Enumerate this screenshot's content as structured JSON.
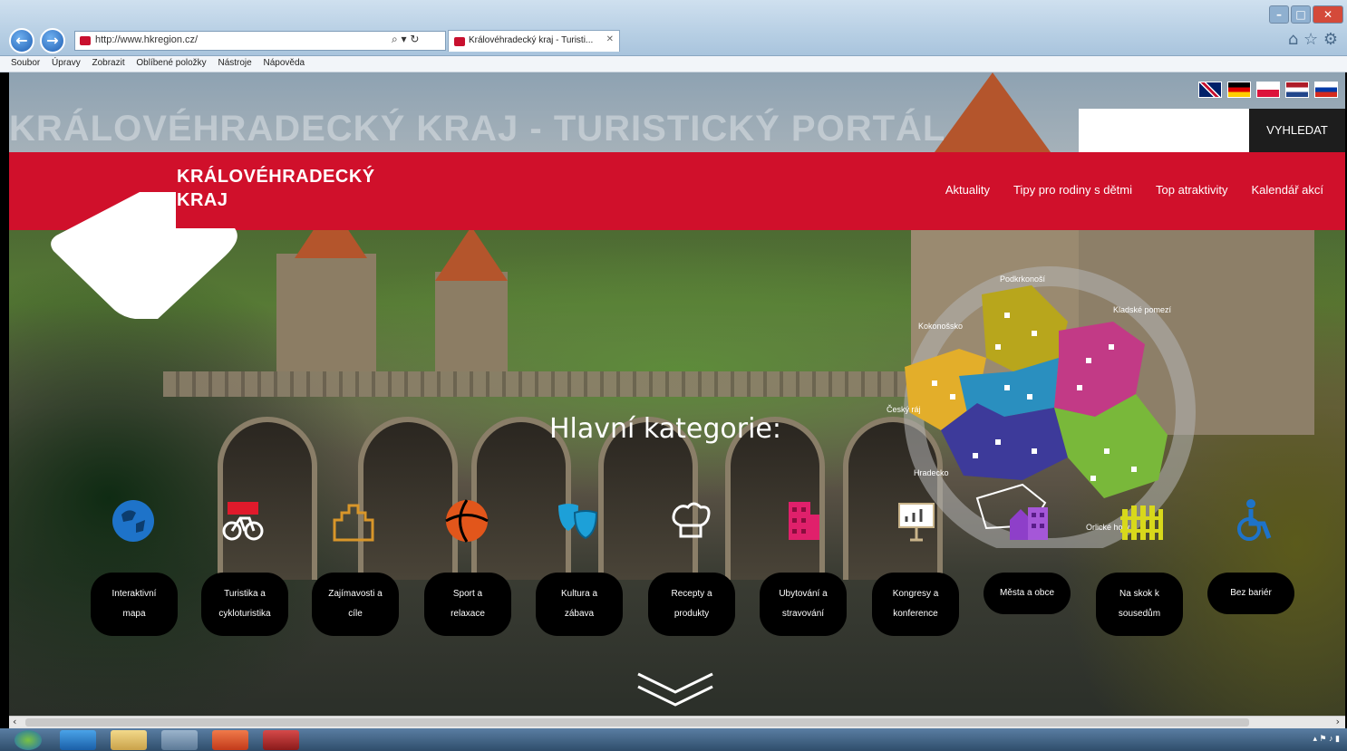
{
  "browser": {
    "address": "http://www.hkregion.cz/",
    "tab_title": "Královéhradecký kraj - Turisti...",
    "menu": [
      "Soubor",
      "Úpravy",
      "Zobrazit",
      "Oblíbené položky",
      "Nástroje",
      "Nápověda"
    ]
  },
  "site": {
    "headline": "KRÁLOVÉHRADECKÝ KRAJ - TURISTICKÝ PORTÁL",
    "logo_line1": "KRÁLOVÉHRADECKÝ",
    "logo_line2": "KRAJ",
    "search_button": "VYHLEDAT",
    "search_value": "",
    "nav": [
      "Aktuality",
      "Tipy pro rodiny s dětmi",
      "Top atraktivity",
      "Kalendář akcí"
    ],
    "categories_title": "Hlavní kategorie:",
    "languages": [
      "English",
      "Deutsch",
      "Polski",
      "Nederlands",
      "Русский"
    ]
  },
  "categories": [
    {
      "line1": "Interaktivní",
      "line2": "mapa",
      "icon": "globe-icon",
      "color": "#1e73c9"
    },
    {
      "line1": "Turistika a",
      "line2": "cykloturistika",
      "icon": "bicycle-icon",
      "color": "#e01a2b"
    },
    {
      "line1": "Zajímavosti a",
      "line2": "cíle",
      "icon": "castle-icon",
      "color": "#d8962a"
    },
    {
      "line1": "Sport a",
      "line2": "relaxace",
      "icon": "ball-icon",
      "color": "#e2561b"
    },
    {
      "line1": "Kultura a",
      "line2": "zábava",
      "icon": "theatre-masks-icon",
      "color": "#1da0d8"
    },
    {
      "line1": "Recepty a",
      "line2": "produkty",
      "icon": "chef-hat-icon",
      "color": "#ffffff"
    },
    {
      "line1": "Ubytování a",
      "line2": "stravování",
      "icon": "hotel-icon",
      "color": "#e0206b"
    },
    {
      "line1": "Kongresy a",
      "line2": "konference",
      "icon": "presentation-icon",
      "color": "#c9b48a"
    },
    {
      "line1": "Města a obce",
      "line2": "",
      "icon": "houses-icon",
      "color": "#8e3fc9"
    },
    {
      "line1": "Na skok k",
      "line2": "sousedům",
      "icon": "fence-icon",
      "color": "#d8d81b"
    },
    {
      "line1": "Bez bariér",
      "line2": "",
      "icon": "wheelchair-icon",
      "color": "#1e73c9"
    }
  ],
  "map": {
    "labels": [
      "Kokonošsko",
      "Podkrkonoší",
      "Kladské pomezí",
      "Orlické hory",
      "Hradecko",
      "Český ráj"
    ]
  }
}
